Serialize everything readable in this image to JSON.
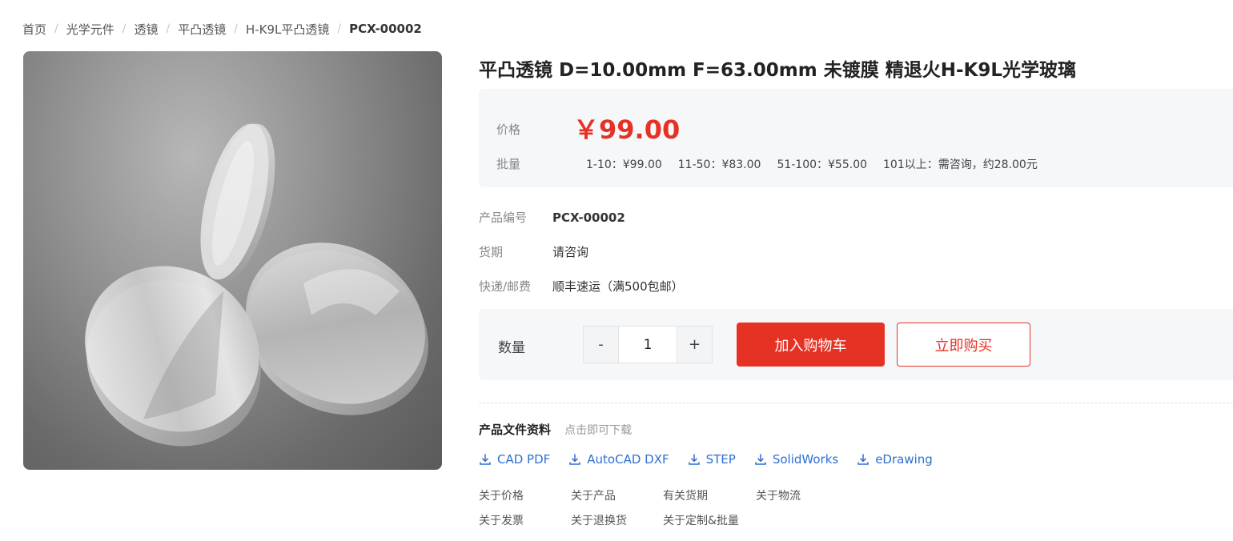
{
  "breadcrumb": [
    {
      "label": "首页"
    },
    {
      "label": "光学元件"
    },
    {
      "label": "透镜"
    },
    {
      "label": "平凸透镜"
    },
    {
      "label": "H-K9L平凸透镜"
    },
    {
      "label": "PCX-00002"
    }
  ],
  "product": {
    "title": "平凸透镜 D=10.00mm F=63.00mm 未镀膜 精退火H-K9L光学玻璃",
    "image_icon": "lens-photo"
  },
  "price": {
    "label": "价格",
    "value": "￥99.00",
    "bulk_label": "批量",
    "tiers": [
      "1-10：¥99.00",
      "11-50：¥83.00",
      "51-100：¥55.00",
      "101以上：需咨询，约28.00元"
    ]
  },
  "info": {
    "sku_label": "产品编号",
    "sku_value": "PCX-00002",
    "delivery_label": "货期",
    "delivery_value": "请咨询",
    "shipping_label": "快递/邮费",
    "shipping_value": "顺丰速运（满500包邮）"
  },
  "quantity": {
    "label": "数量",
    "minus": "-",
    "value": "1",
    "plus": "+"
  },
  "actions": {
    "add_to_cart": "加入购物车",
    "buy_now": "立即购买"
  },
  "files": {
    "title": "产品文件资料",
    "subtitle": "点击即可下载",
    "icon": "download-icon",
    "links": [
      "CAD PDF",
      "AutoCAD DXF",
      "STEP",
      "SolidWorks",
      "eDrawing"
    ]
  },
  "faq": [
    "关于价格",
    "关于产品",
    "有关货期",
    "关于物流",
    "关于发票",
    "关于退换货",
    "关于定制&批量"
  ],
  "colors": {
    "accent": "#e63225",
    "link": "#2f6fd0",
    "panel_bg": "#f6f7f9"
  }
}
